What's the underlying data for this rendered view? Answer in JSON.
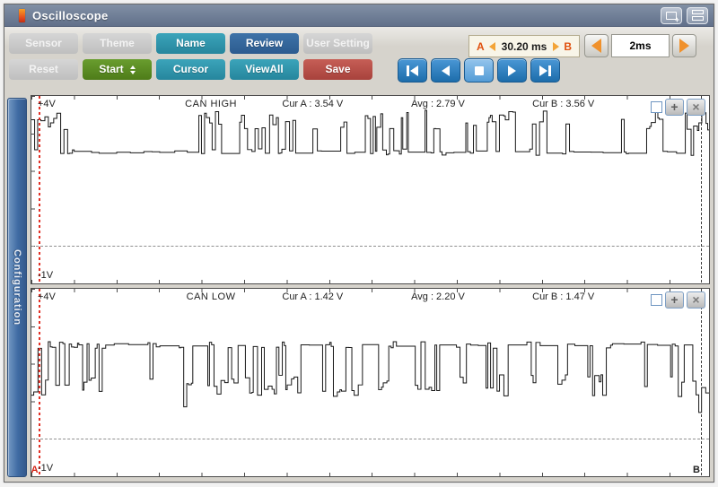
{
  "window": {
    "title": "Oscilloscope"
  },
  "titlebar": {
    "icons": [
      "new-window-icon",
      "tile-windows-icon"
    ]
  },
  "colors": {
    "titlebar": "#66738b",
    "toolbar_bg": "#d6d3cc",
    "teal": "#2e95ac",
    "blue": "#33679b",
    "green": "#5b8f22",
    "red": "#bf4d49",
    "transport_blue": "#2a7fc2",
    "cursor_a": "#e23025",
    "cursor_b": "#3a3a3a",
    "readout_bg": "#f8f5e8",
    "accent_orange": "#f0912c"
  },
  "toolbar": {
    "row1": [
      {
        "label": "Sensor",
        "variant": "disabled"
      },
      {
        "label": "Theme",
        "variant": "disabled"
      },
      {
        "label": "Name",
        "variant": "teal"
      },
      {
        "label": "Review",
        "variant": "blue"
      },
      {
        "label": "User Setting",
        "variant": "disabled"
      }
    ],
    "row2": [
      {
        "label": "Reset",
        "variant": "disabled"
      },
      {
        "label": "Start",
        "variant": "green",
        "has_spinner": true
      },
      {
        "label": "Cursor",
        "variant": "teal"
      },
      {
        "label": "ViewAll",
        "variant": "teal"
      },
      {
        "label": "Save",
        "variant": "red"
      }
    ]
  },
  "cursor_readout": {
    "a_label": "A",
    "value": "30.20 ms",
    "b_label": "B"
  },
  "timebase": {
    "value": "2ms",
    "icons": [
      "arrow-left-icon",
      "arrow-right-icon"
    ]
  },
  "transport": {
    "icons": [
      "skip-to-start-icon",
      "step-back-icon",
      "stop-icon",
      "step-forward-icon",
      "skip-to-end-icon"
    ]
  },
  "sidebar": {
    "label": "Configuration"
  },
  "panels": [
    {
      "title": "CAN HIGH",
      "vmax_label": "+4V",
      "vmin_label": "-1V",
      "cur_a": "Cur A : 3.54 V",
      "avg": "Avg : 2.79 V",
      "cur_b": "Cur B : 3.56 V",
      "checkbox_checked": false,
      "waveform": {
        "seed": 11,
        "vmax": 4,
        "vmin": -1,
        "grid_v": 0,
        "recessive_v": 2.5,
        "dominant_v": 3.35,
        "jitter": 0.55,
        "density": 0.55,
        "deep_v": null,
        "cursor_a": 0.01,
        "cursor_b": 0.988,
        "bursts": [
          [
            0,
            0.062
          ],
          [
            0.245,
            0.28
          ],
          [
            0.3,
            0.388
          ],
          [
            0.402,
            0.425
          ],
          [
            0.445,
            0.465
          ],
          [
            0.482,
            0.555
          ],
          [
            0.57,
            0.61
          ],
          [
            0.625,
            0.655
          ],
          [
            0.672,
            0.712
          ],
          [
            0.73,
            0.76
          ],
          [
            0.778,
            0.8
          ],
          [
            0.845,
            0.878
          ],
          [
            0.893,
            0.938
          ],
          [
            0.962,
            1.0
          ]
        ]
      }
    },
    {
      "title": "CAN LOW",
      "vmax_label": "+4V",
      "vmin_label": "-1V",
      "cur_a": "Cur A : 1.42 V",
      "avg": "Avg : 2.20 V",
      "cur_b": "Cur B : 1.47 V",
      "checkbox_checked": false,
      "marker_a": "A",
      "marker_b": "B",
      "waveform": {
        "seed": 23,
        "vmax": 4,
        "vmin": -1,
        "grid_v": 0,
        "recessive_v": 2.5,
        "dominant_v": 1.42,
        "jitter": 0.6,
        "density": 0.58,
        "deep_v": 0.6,
        "cursor_a": 0.01,
        "cursor_b": 0.988,
        "bursts": [
          [
            0,
            0.105
          ],
          [
            0.155,
            0.185
          ],
          [
            0.205,
            0.238
          ],
          [
            0.255,
            0.3
          ],
          [
            0.315,
            0.395
          ],
          [
            0.425,
            0.485
          ],
          [
            0.505,
            0.535
          ],
          [
            0.56,
            0.6
          ],
          [
            0.618,
            0.645
          ],
          [
            0.66,
            0.7
          ],
          [
            0.715,
            0.745
          ],
          [
            0.762,
            0.79
          ],
          [
            0.815,
            0.855
          ],
          [
            0.878,
            0.908
          ],
          [
            0.932,
            0.96
          ],
          [
            0.975,
            1.0
          ]
        ]
      }
    }
  ]
}
